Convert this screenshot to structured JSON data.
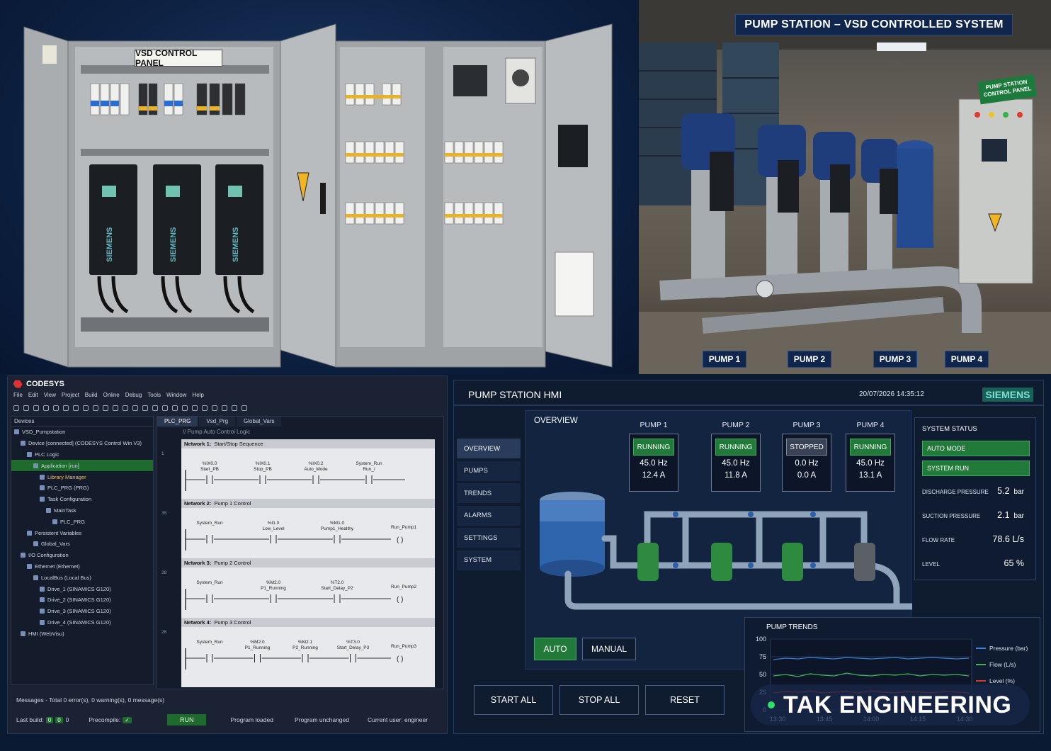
{
  "photos": {
    "panel_sign": "VSD CONTROL PANEL",
    "station_banner": "PUMP STATION – VSD CONTROLLED SYSTEM",
    "control_panel_sign": "PUMP STATION CONTROL PANEL",
    "drive_brand": "SIEMENS",
    "pump_labels": [
      "PUMP 1",
      "PUMP 2",
      "PUMP 3",
      "PUMP 4"
    ]
  },
  "ide": {
    "title": "CODESYS",
    "menu": [
      "File",
      "Edit",
      "View",
      "Project",
      "Build",
      "Online",
      "Debug",
      "Tools",
      "Window",
      "Help"
    ],
    "devices_header": "Devices",
    "tree": [
      {
        "label": "VSD_Pumpstation",
        "indent": 0,
        "style": ""
      },
      {
        "label": "Device [connected] (CODESYS Control Win V3)",
        "indent": 1,
        "style": ""
      },
      {
        "label": "PLC Logic",
        "indent": 2,
        "style": ""
      },
      {
        "label": "Application [run]",
        "indent": 3,
        "style": "hl"
      },
      {
        "label": "Library Manager",
        "indent": 4,
        "style": "lib"
      },
      {
        "label": "PLC_PRG (PRG)",
        "indent": 4,
        "style": ""
      },
      {
        "label": "Task Configuration",
        "indent": 4,
        "style": ""
      },
      {
        "label": "MainTask",
        "indent": 5,
        "style": ""
      },
      {
        "label": "PLC_PRG",
        "indent": 6,
        "style": ""
      },
      {
        "label": "Persistent Variables",
        "indent": 2,
        "style": ""
      },
      {
        "label": "Global_Vars",
        "indent": 3,
        "style": ""
      },
      {
        "label": "I/O Configuration",
        "indent": 1,
        "style": ""
      },
      {
        "label": "Ethernet (Ethernet)",
        "indent": 2,
        "style": ""
      },
      {
        "label": "LocalBus (Local Bus)",
        "indent": 3,
        "style": ""
      },
      {
        "label": "Drive_1 (SINAMICS G120)",
        "indent": 4,
        "style": ""
      },
      {
        "label": "Drive_2 (SINAMICS G120)",
        "indent": 4,
        "style": ""
      },
      {
        "label": "Drive_3 (SINAMICS G120)",
        "indent": 4,
        "style": ""
      },
      {
        "label": "Drive_4 (SINAMICS G120)",
        "indent": 4,
        "style": ""
      },
      {
        "label": "HMI (WebVisu)",
        "indent": 1,
        "style": ""
      }
    ],
    "tabs": [
      "PLC_PRG",
      "Vsd_Prg",
      "Global_Vars"
    ],
    "editor_comment": "// Pump Auto Control Logic",
    "networks": [
      {
        "no": "1",
        "head": "Network 1:",
        "title": "Start/Stop Sequence",
        "line": "1",
        "contacts": [
          [
            "%IX0.0",
            "Start_PB"
          ],
          [
            "%IX0.1",
            "Stop_PB"
          ],
          [
            "%IX0.2",
            "Auto_Mode"
          ],
          [
            "System_Run",
            "Run_/"
          ]
        ],
        "coil": ""
      },
      {
        "no": "2",
        "head": "Network 2:",
        "title": "Pump 1 Control",
        "line": "35",
        "contacts": [
          [
            "",
            "System_Run"
          ],
          [
            "%I1.0",
            "Low_Level"
          ],
          [
            "%M1.0",
            "Pump1_Healthy"
          ]
        ],
        "coil": "Run_Pump1"
      },
      {
        "no": "3",
        "head": "Network 3:",
        "title": "Pump 2 Control",
        "line": "28",
        "contacts": [
          [
            "",
            "System_Run"
          ],
          [
            "%M2.0",
            "P1_Running"
          ],
          [
            "%T2.0",
            "Start_Delay_P2"
          ]
        ],
        "coil": "Run_Pump2"
      },
      {
        "no": "4",
        "head": "Network 4:",
        "title": "Pump 3 Control",
        "line": "28",
        "contacts": [
          [
            "",
            "System_Run"
          ],
          [
            "%M2.0",
            "P1_Running"
          ],
          [
            "%M2.1",
            "P2_Running"
          ],
          [
            "%T3.0",
            "Start_Delay_P3"
          ]
        ],
        "coil": "Run_Pump3"
      }
    ],
    "messages": "Messages - Total 0 error(s), 0 warning(s), 0 message(s)",
    "status": {
      "last_build": "Last build:",
      "build_counts": [
        "0",
        "0"
      ],
      "build_zero": "0",
      "precompile": "Precompile:",
      "precompile_mark": "✓",
      "run": "RUN",
      "program_loaded": "Program loaded",
      "program_unchanged": "Program unchanged",
      "current_user": "Current user: engineer"
    }
  },
  "hmi": {
    "title": "PUMP STATION HMI",
    "datetime": "20/07/2026  14:35:12",
    "brand": "SIEMENS",
    "nav": [
      "OVERVIEW",
      "PUMPS",
      "TRENDS",
      "ALARMS",
      "SETTINGS",
      "SYSTEM"
    ],
    "overview_title": "OVERVIEW",
    "pumps": [
      {
        "name": "PUMP 1",
        "state": "RUNNING",
        "freq": "45.0 Hz",
        "current": "12.4 A",
        "running": true
      },
      {
        "name": "PUMP 2",
        "state": "RUNNING",
        "freq": "45.0 Hz",
        "current": "11.8 A",
        "running": true
      },
      {
        "name": "PUMP 3",
        "state": "STOPPED",
        "freq": "0.0 Hz",
        "current": "0.0 A",
        "running": false
      },
      {
        "name": "PUMP 4",
        "state": "RUNNING",
        "freq": "45.0 Hz",
        "current": "13.1 A",
        "running": true
      }
    ],
    "mode": {
      "auto": "AUTO",
      "manual": "MANUAL"
    },
    "actions": {
      "start_all": "START ALL",
      "stop_all": "STOP ALL",
      "reset": "RESET"
    },
    "system_status": {
      "title": "SYSTEM STATUS",
      "auto_mode": "AUTO MODE",
      "system_run": "SYSTEM RUN",
      "discharge_label": "DISCHARGE PRESSURE",
      "discharge_value": "5.2",
      "discharge_unit": "bar",
      "suction_label": "SUCTION PRESSURE",
      "suction_value": "2.1",
      "suction_unit": "bar",
      "flow_label": "FLOW RATE",
      "flow_value": "78.6 L/s",
      "level_label": "LEVEL",
      "level_value": "65 %"
    },
    "colors": {
      "running": "#217a3a",
      "stopped": "#3a4356",
      "pressure": "#3b82d6",
      "flow": "#3fb34f",
      "level": "#d9342b"
    }
  },
  "chart_data": {
    "type": "line",
    "title": "PUMP TRENDS",
    "x": [
      "13:30",
      "13:45",
      "14:00",
      "14:15",
      "14:30"
    ],
    "yticks": [
      "100",
      "75",
      "50",
      "25",
      "0"
    ],
    "ylim": [
      0,
      100
    ],
    "series": [
      {
        "name": "Pressure (bar)",
        "color": "#3b82d6",
        "values": [
          71,
          73,
          72,
          74,
          73,
          72,
          74,
          73,
          72,
          73,
          74,
          72,
          73,
          74,
          73,
          72,
          73
        ]
      },
      {
        "name": "Flow (L/s)",
        "color": "#3fb34f",
        "values": [
          48,
          50,
          47,
          51,
          49,
          48,
          52,
          49,
          48,
          50,
          49,
          51,
          48,
          50,
          49,
          50,
          48
        ]
      },
      {
        "name": "Level (%)",
        "color": "#d9342b",
        "values": [
          24,
          26,
          25,
          27,
          24,
          25,
          26,
          24,
          27,
          25,
          24,
          26,
          25,
          24,
          26,
          25,
          24
        ]
      }
    ]
  },
  "watermark": "TAK ENGINEERING"
}
